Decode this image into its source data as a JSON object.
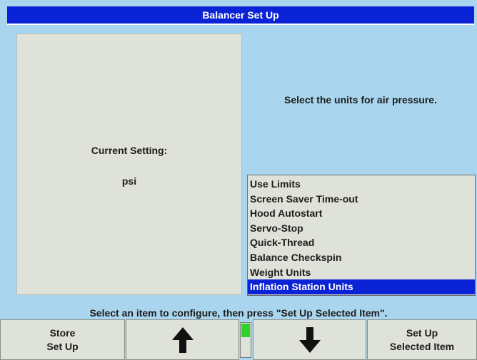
{
  "window": {
    "title": "Balancer Set Up"
  },
  "left_panel": {
    "current_label": "Current Setting:",
    "current_value": "psi"
  },
  "right_panel": {
    "instruction": "Select the units for air pressure."
  },
  "menu": {
    "items": [
      "Use Limits",
      "Screen Saver Time-out",
      "Hood Autostart",
      "Servo-Stop",
      "Quick-Thread",
      "Balance Checkspin",
      "Weight Units",
      "Inflation Station Units"
    ],
    "selected_index": 7
  },
  "status": {
    "text": "Select an item to configure, then press \"Set Up Selected Item\"."
  },
  "softkeys": {
    "store_label": "Store\nSet Up",
    "up_icon": "arrow-up-icon",
    "down_icon": "arrow-down-icon",
    "setup_label": "Set Up\nSelected Item"
  },
  "scroll_indicator": {
    "level": 0.4
  },
  "colors": {
    "background": "#a9d6ee",
    "title_bar": "#0b23d6",
    "panel": "#dfe2d8",
    "selection": "#0b23d6",
    "indicator": "#2ed32a"
  }
}
